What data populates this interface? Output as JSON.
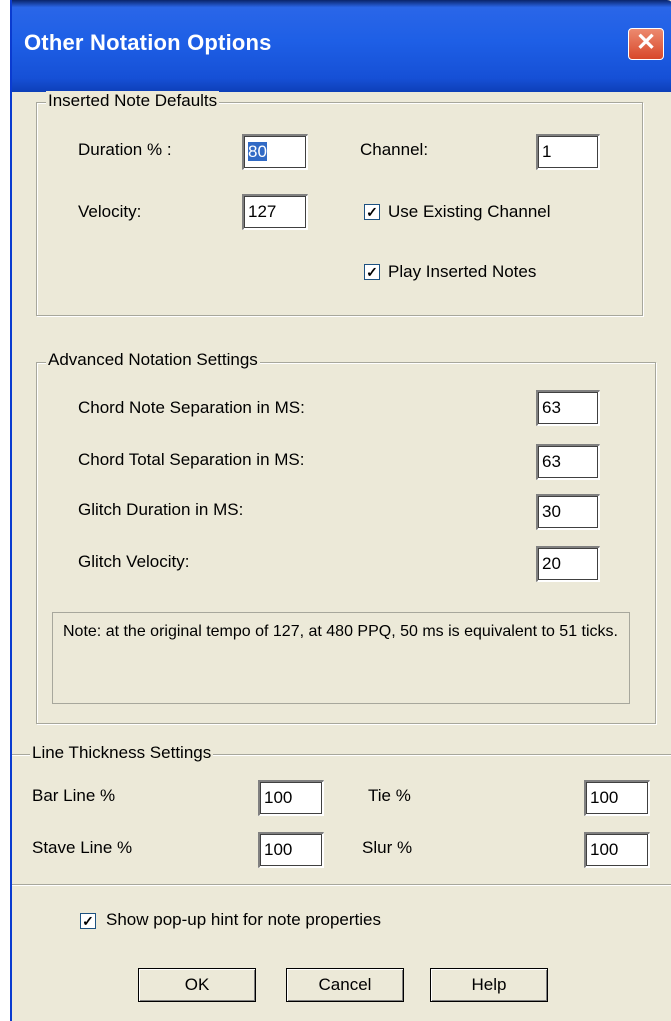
{
  "window": {
    "title": "Other Notation Options",
    "close_glyph": "✕"
  },
  "inserted_note_defaults": {
    "legend": "Inserted Note Defaults",
    "duration_label": "Duration % :",
    "duration_value": "80",
    "velocity_label": "Velocity:",
    "velocity_value": "127",
    "channel_label": "Channel:",
    "channel_value": "1",
    "use_existing_channel_label": "Use Existing Channel",
    "use_existing_channel_checked": true,
    "play_inserted_notes_label": "Play Inserted Notes",
    "play_inserted_notes_checked": true
  },
  "advanced": {
    "legend": "Advanced Notation Settings",
    "chord_note_sep_label": "Chord Note Separation in MS:",
    "chord_note_sep_value": "63",
    "chord_total_sep_label": "Chord Total Separation in MS:",
    "chord_total_sep_value": "63",
    "glitch_duration_label": "Glitch Duration in MS:",
    "glitch_duration_value": "30",
    "glitch_velocity_label": "Glitch Velocity:",
    "glitch_velocity_value": "20",
    "note_text": "Note: at the original tempo of 127, at 480 PPQ, 50 ms is equivalent to 51 ticks."
  },
  "line_thickness": {
    "legend": "Line Thickness Settings",
    "bar_line_label": "Bar Line %",
    "bar_line_value": "100",
    "stave_line_label": "Stave Line %",
    "stave_line_value": "100",
    "tie_label": "Tie %",
    "tie_value": "100",
    "slur_label": "Slur %",
    "slur_value": "100"
  },
  "show_popup_hint": {
    "label": "Show pop-up hint for note properties",
    "checked": true
  },
  "buttons": {
    "ok": "OK",
    "cancel": "Cancel",
    "help": "Help"
  },
  "check_glyph": "✓"
}
